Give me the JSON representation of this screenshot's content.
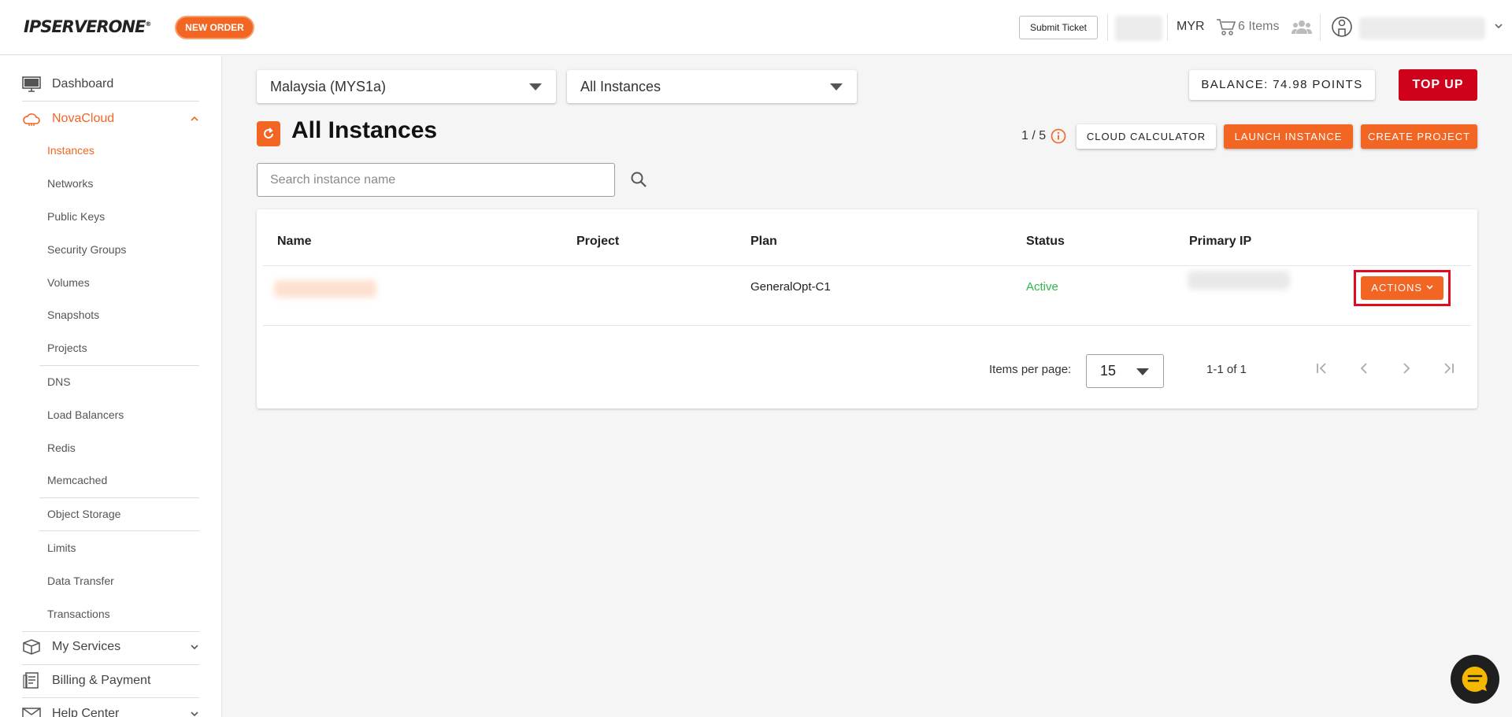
{
  "header": {
    "logo": "IPSERVERONE",
    "new_order": "NEW ORDER",
    "submit_ticket": "Submit Ticket",
    "currency": "MYR",
    "cart_label": "6 Items"
  },
  "sidebar": {
    "dashboard": "Dashboard",
    "novacloud": "NovaCloud",
    "sub_items": [
      "Instances",
      "Networks",
      "Public Keys",
      "Security Groups",
      "Volumes",
      "Snapshots",
      "Projects",
      "DNS",
      "Load Balancers",
      "Redis",
      "Memcached",
      "Object Storage",
      "Limits",
      "Data Transfer",
      "Transactions"
    ],
    "my_services": "My Services",
    "billing": "Billing & Payment",
    "help_center": "Help Center"
  },
  "filters": {
    "region": "Malaysia (MYS1a)",
    "instance_filter": "All Instances"
  },
  "balance": {
    "label": "BALANCE: 74.98 POINTS",
    "top_up": "TOP UP"
  },
  "page": {
    "title": "All Instances",
    "quota": "1 / 5",
    "cloud_calculator": "CLOUD CALCULATOR",
    "launch_instance": "LAUNCH INSTANCE",
    "create_project": "CREATE PROJECT",
    "search_placeholder": "Search instance name"
  },
  "table": {
    "columns": [
      "Name",
      "Project",
      "Plan",
      "Status",
      "Primary IP"
    ],
    "rows": [
      {
        "name": "",
        "project": "",
        "plan": "GeneralOpt-C1",
        "status": "Active",
        "ip": "",
        "actions": "ACTIONS"
      }
    ]
  },
  "pagination": {
    "items_per_page_label": "Items per page:",
    "items_per_page": "15",
    "range": "1-1 of 1"
  },
  "colors": {
    "brand_orange": "#f26522",
    "top_up_red": "#d0021b",
    "status_active": "#2db84b",
    "highlight_frame": "#e10a1e"
  }
}
